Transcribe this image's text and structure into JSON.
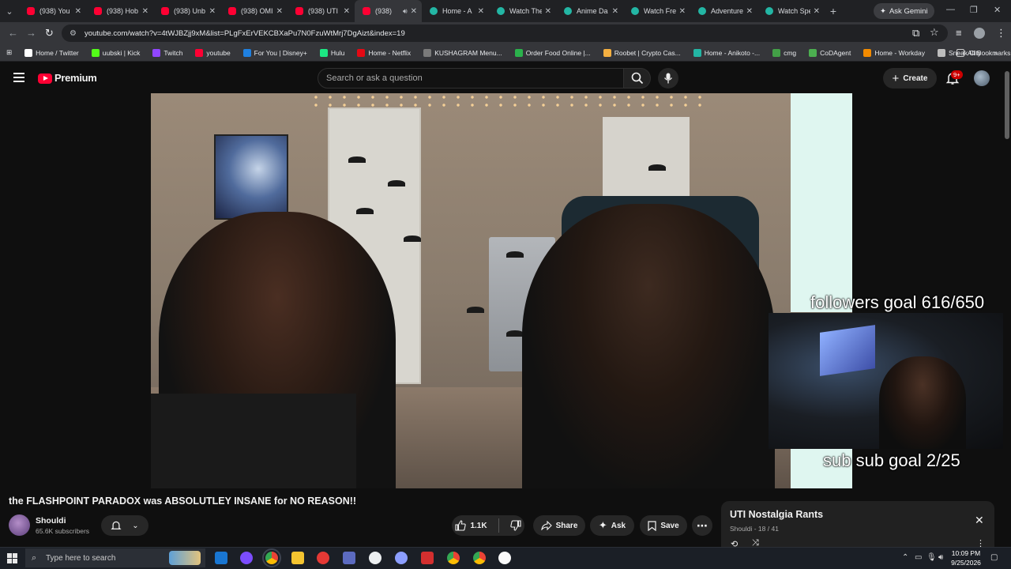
{
  "browser": {
    "tabs": [
      {
        "label": "(938) You",
        "icon": "youtube-icon",
        "active": false
      },
      {
        "label": "(938) Hob",
        "icon": "youtube-icon",
        "active": false
      },
      {
        "label": "(938) Unb",
        "icon": "youtube-icon",
        "active": false
      },
      {
        "label": "(938) OMI",
        "icon": "youtube-icon",
        "active": false
      },
      {
        "label": "(938) UTI",
        "icon": "youtube-icon",
        "active": false
      },
      {
        "label": "(938)",
        "icon": "youtube-icon",
        "active": true
      },
      {
        "label": "Home - A",
        "icon": "teal-globe-icon",
        "active": false
      },
      {
        "label": "Watch The",
        "icon": "teal-globe-icon",
        "active": false
      },
      {
        "label": "Anime Da",
        "icon": "teal-globe-icon",
        "active": false
      },
      {
        "label": "Watch Fre",
        "icon": "teal-globe-icon",
        "active": false
      },
      {
        "label": "Adventure",
        "icon": "teal-globe-icon",
        "active": false
      },
      {
        "label": "Watch Spe",
        "icon": "teal-globe-icon",
        "active": false
      }
    ],
    "ask_gemini": "Ask Gemini",
    "url": "youtube.com/watch?v=4tWJBZjj9xM&list=PLgFxErVEKCBXaPu7N0FzuWtMrj7DgAizt&index=19",
    "bookmarks": [
      {
        "label": "Home / Twitter",
        "color": "#ffffff"
      },
      {
        "label": "uubski | Kick",
        "color": "#53fc18"
      },
      {
        "label": "Twitch",
        "color": "#9146ff"
      },
      {
        "label": "youtube",
        "color": "#ff0033"
      },
      {
        "label": "For You | Disney+",
        "color": "#1f80e0"
      },
      {
        "label": "Hulu",
        "color": "#1ce783"
      },
      {
        "label": "Home - Netflix",
        "color": "#e50914"
      },
      {
        "label": "KUSHAGRAM Menu...",
        "color": "#7a7a7a"
      },
      {
        "label": "Order Food Online |...",
        "color": "#2bb24c"
      },
      {
        "label": "Roobet | Crypto Cas...",
        "color": "#f5b041"
      },
      {
        "label": "Home - Anikoto -...",
        "color": "#23b6a4"
      },
      {
        "label": "cmg",
        "color": "#43a047"
      },
      {
        "label": "CoDAgent",
        "color": "#4caf50"
      },
      {
        "label": "Home - Workday",
        "color": "#f38b00"
      },
      {
        "label": "Sneak City",
        "color": "#bdbdbd"
      }
    ],
    "all_bookmarks": "All Bookmarks"
  },
  "youtube": {
    "brand": "Premium",
    "search_placeholder": "Search or ask a question",
    "create_label": "Create",
    "notification_count": "9+"
  },
  "video": {
    "overlay_followers": "followers goal 616/650",
    "overlay_subs": "sub sub goal 2/25",
    "title": "the FLASHPOINT PARADOX was ABSOLUTLEY INSANE for NO REASON!!",
    "channel": "Shouldi",
    "subscribers": "65.6K subscribers",
    "likes": "1.1K",
    "share": "Share",
    "ask": "Ask",
    "save": "Save"
  },
  "playlist": {
    "title": "UTI Nostalgia Rants",
    "owner": "Shouldi",
    "position": "18 / 41"
  },
  "taskbar": {
    "search_placeholder": "Type here to search",
    "time": "10:09 PM",
    "date": "9/25/2026"
  }
}
